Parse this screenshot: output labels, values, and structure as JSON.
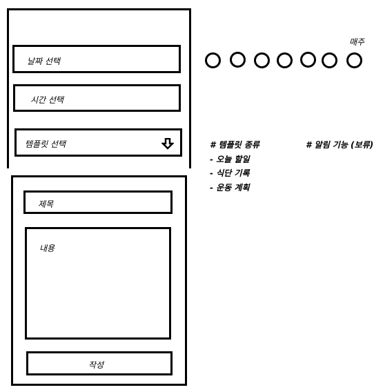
{
  "schedule_form": {
    "date_field": "날짜 선택",
    "time_field": "시간 선택",
    "template_select": "템플릿 선택",
    "template_icon": "arrow-down-icon"
  },
  "write_form": {
    "title_field": "제목",
    "content_field": "내용",
    "submit_label": "작성"
  },
  "weekly": {
    "label": "매주",
    "days": 7
  },
  "notes": {
    "template_types_heading": "# 템플릿 종류",
    "template_types": [
      "- 오늘 할일",
      "- 식단 기록",
      "- 운동 계획"
    ],
    "alarm_heading": "# 알림 기능 (보류)"
  }
}
